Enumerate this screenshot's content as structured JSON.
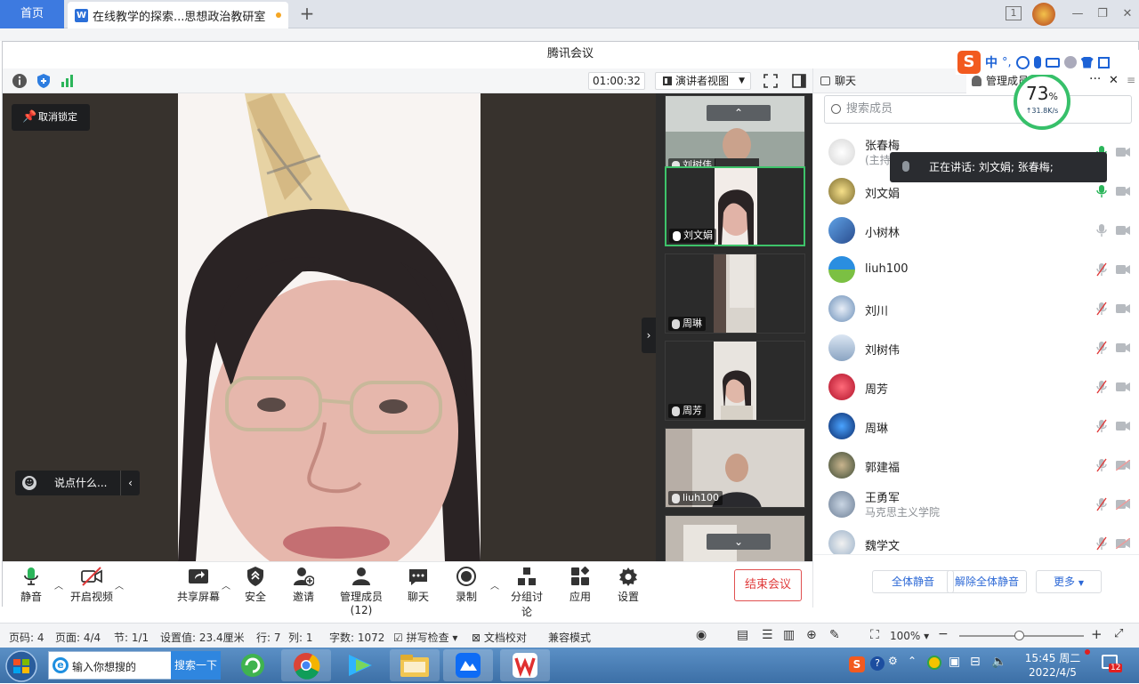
{
  "wps": {
    "home_tab": "首页",
    "doc_tab": "在线教学的探索...思想政治教研室",
    "new_tab": "+",
    "badge": "1"
  },
  "meeting": {
    "title": "腾讯会议",
    "timer": "01:00:32",
    "view_mode": "演讲者视图",
    "unlock": "取消锁定",
    "comment_placeholder": "说点什么..."
  },
  "thumbnails": [
    {
      "name": "刘树伟",
      "active": false
    },
    {
      "name": "刘文娟",
      "active": true
    },
    {
      "name": "周琳",
      "active": false
    },
    {
      "name": "周芳",
      "active": false
    },
    {
      "name": "liuh100",
      "active": false
    }
  ],
  "toolbar": {
    "mute": "静音",
    "video": "开启视频",
    "share": "共享屏幕",
    "security": "安全",
    "invite": "邀请",
    "members": "管理成员(12)",
    "chat": "聊天",
    "record": "录制",
    "breakout": "分组讨论",
    "apps": "应用",
    "settings": "设置",
    "end": "结束会议"
  },
  "panel": {
    "chat_tab": "聊天",
    "members_tab": "管理成员(1",
    "search_placeholder": "搜索成员",
    "speaking_tip": "正在讲话: 刘文娟; 张春梅;",
    "mute_all": "全体静音",
    "unmute_all": "解除全体静音",
    "more": "更多",
    "members": [
      {
        "name": "张春梅",
        "sub": "(主持",
        "mic": "active",
        "cam": "off"
      },
      {
        "name": "刘文娟",
        "sub": "",
        "mic": "active",
        "cam": "off"
      },
      {
        "name": "小树林",
        "sub": "",
        "mic": "idle",
        "cam": "off"
      },
      {
        "name": "liuh100",
        "sub": "",
        "mic": "muted",
        "cam": "off"
      },
      {
        "name": "刘川",
        "sub": "",
        "mic": "muted",
        "cam": "off"
      },
      {
        "name": "刘树伟",
        "sub": "",
        "mic": "muted",
        "cam": "off"
      },
      {
        "name": "周芳",
        "sub": "",
        "mic": "muted",
        "cam": "off"
      },
      {
        "name": "周琳",
        "sub": "",
        "mic": "muted",
        "cam": "off"
      },
      {
        "name": "郭建福",
        "sub": "",
        "mic": "muted",
        "cam": "disabled"
      },
      {
        "name": "王勇军",
        "sub": "马克思主义学院",
        "mic": "muted",
        "cam": "disabled"
      },
      {
        "name": "魏学文",
        "sub": "",
        "mic": "muted",
        "cam": "disabled"
      }
    ]
  },
  "network": {
    "percent": "73",
    "unit": "%",
    "speed": "↑31.8K/s"
  },
  "ime": {
    "lang": "中",
    "punct": "°,"
  },
  "status": {
    "page_num": "页码: 4",
    "pages": "页面: 4/4",
    "section": "节: 1/1",
    "setting": "设置值: 23.4厘米",
    "row": "行: 7",
    "col": "列: 1",
    "words": "字数: 1072",
    "spell": "拼写检查",
    "proof": "文档校对",
    "compat": "兼容模式",
    "zoom": "100%"
  },
  "taskbar": {
    "search_placeholder": "输入你想搜的",
    "search_btn": "搜索一下",
    "time": "15:45 周二",
    "date": "2022/4/5",
    "notif_count": "12"
  },
  "colors": {
    "accent": "#3d7ae0",
    "active_green": "#3ec36a",
    "danger": "#e03a3a"
  }
}
